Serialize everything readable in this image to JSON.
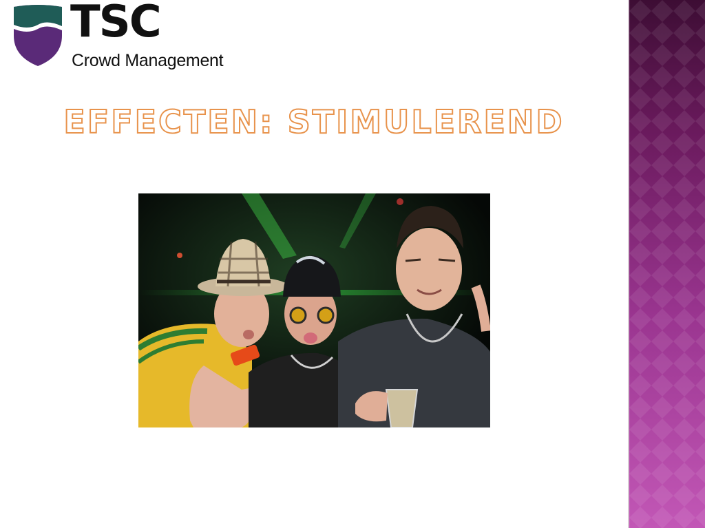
{
  "logo": {
    "name": "TSC",
    "tagline": "Crowd Management",
    "colors": {
      "shield_top": "#1f5c57",
      "shield_bottom": "#5a2a78",
      "text": "#111111"
    }
  },
  "slide": {
    "title": "Effecten: Stimulerend",
    "title_color": "#e8934c"
  },
  "photo": {
    "subject": "three-young-men-at-party-photo"
  },
  "side_band": {
    "colors": [
      "#3d0d34",
      "#6a1a5d",
      "#9a3590",
      "#c257b6"
    ]
  }
}
